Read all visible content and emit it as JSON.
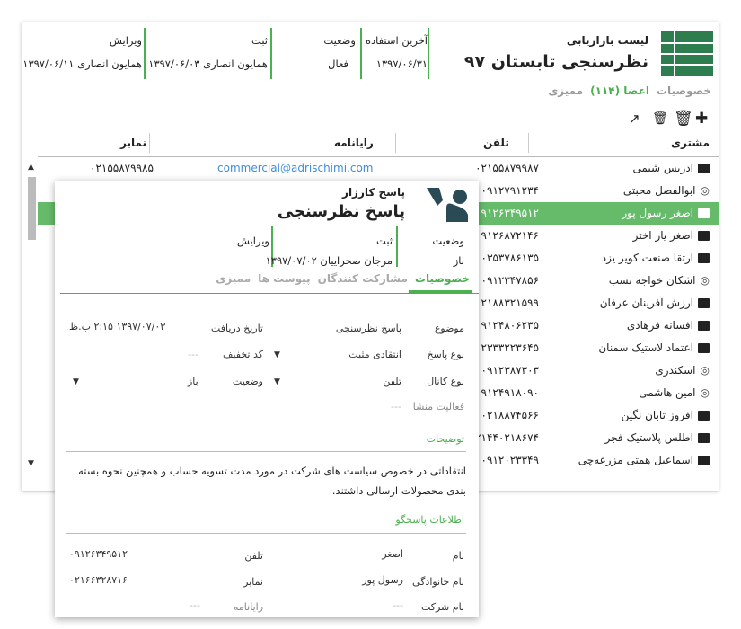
{
  "header": {
    "list_label": "لیست بازاریابی",
    "title": "نظرسنجی تابستان ۹۷",
    "fields": [
      {
        "label": "آخرین استفاده",
        "value": "۱۳۹۷/۰۶/۳۱"
      },
      {
        "label": "وضعیت",
        "value": "فعال"
      },
      {
        "label": "ثبت",
        "value": "همایون انصاری ۱۳۹۷/۰۶/۰۳"
      },
      {
        "label": "ویرایش",
        "value": "همایون انصاری ۱۳۹۷/۰۶/۱۱"
      }
    ],
    "tabs": [
      "خصوصیات",
      "اعضا (۱۱۴)",
      "ممیزی"
    ],
    "toolbar_icons": [
      "add-icon",
      "delete-icon",
      "delete-multiple-icon",
      "open-external-icon"
    ]
  },
  "table": {
    "columns": [
      "مشتری",
      "تلفن",
      "رایانامه",
      "نمابر"
    ],
    "rows": [
      {
        "name": "ادریس شیمی",
        "icon": "contact-card-icon",
        "phone": "۰۲۱۵۵۸۷۹۹۸۷",
        "email": "commercial@adrischimi.com",
        "fax": "۰۲۱۵۵۸۷۹۹۸۵"
      },
      {
        "name": "ابوالفضل محبتی",
        "icon": "fingerprint-icon",
        "phone": "۰۹۱۲۷۹۱۲۳۴",
        "email": "",
        "fax": ""
      },
      {
        "name": "اصغر رسول پور",
        "icon": "contact-card-icon",
        "phone": "۰۹۱۲۶۳۴۹۵۱۲",
        "email": "",
        "fax": "",
        "selected": true
      },
      {
        "name": "اصغر یار اختر",
        "icon": "contact-card-icon",
        "phone": "۰۹۱۲۶۸۷۲۱۴۶",
        "email": "",
        "fax": ""
      },
      {
        "name": "ارتقا صنعت کویر یزد",
        "icon": "contact-card-icon",
        "phone": "۰۳۵۳۷۸۶۱۳۵",
        "email": "",
        "fax": ""
      },
      {
        "name": "اشکان خواجه نسب",
        "icon": "fingerprint-icon",
        "phone": "۰۹۱۲۳۴۷۸۵۶",
        "email": "",
        "fax": ""
      },
      {
        "name": "ارزش آفرینان عرفان",
        "icon": "contact-card-icon",
        "phone": "۰۲۱۸۸۳۲۱۵۹۹",
        "email": "",
        "fax": ""
      },
      {
        "name": "افسانه فرهادی",
        "icon": "contact-card-icon",
        "phone": "۰۹۱۲۴۸۰۶۲۳۵",
        "email": "",
        "fax": ""
      },
      {
        "name": "اعتماد لاستیک سمنان",
        "icon": "contact-card-icon",
        "phone": "۰۲۳۳۳۲۲۳۶۴۵",
        "email": "",
        "fax": ""
      },
      {
        "name": "اسکندری",
        "icon": "fingerprint-icon",
        "phone": "۰۹۱۲۳۸۷۳۰۳",
        "email": "",
        "fax": ""
      },
      {
        "name": "امین هاشمی",
        "icon": "fingerprint-icon",
        "phone": "۰۹۱۲۴۹۱۸۰۹۰",
        "email": "",
        "fax": ""
      },
      {
        "name": "افروز تابان نگین",
        "icon": "contact-card-icon",
        "phone": "۰۲۱۸۸۷۴۵۶۶",
        "email": "",
        "fax": ""
      },
      {
        "name": "اطلس پلاستیک فجر",
        "icon": "contact-card-icon",
        "phone": "۰۲۱۴۴۰۲۱۸۶۷۴",
        "email": "",
        "fax": ""
      },
      {
        "name": "اسماعیل همتی مزرعه‌چی",
        "icon": "contact-card-icon",
        "phone": "۰۹۱۲۰۲۳۳۴۹",
        "email": "",
        "fax": ""
      }
    ]
  },
  "popup": {
    "subtitle": "پاسخ کارزار",
    "title": "پاسخ نظرسنجی",
    "fields": [
      {
        "label": "وضعیت",
        "value": "باز"
      },
      {
        "label": "ثبت",
        "value": "مرجان صحراییان ۱۳۹۷/۰۷/۰۲"
      },
      {
        "label": "ویرایش",
        "value": ""
      }
    ],
    "tabs": [
      "خصوصیات",
      "مشارکت کنندگان",
      "پیوست ها",
      "ممیزی"
    ],
    "form": {
      "subject_label": "موضوع",
      "subject_value": "پاسخ نظرسنجی",
      "received_label": "تاریخ دریافت",
      "received_value": "۱۳۹۷/۰۷/۰۳ ۲:۱۵ ب.ظ",
      "response_type_label": "نوع پاسخ",
      "response_type_value": "انتقادی مثبت",
      "discount_label": "کد تخفیف",
      "discount_value": "---",
      "channel_label": "نوع کانال",
      "channel_value": "تلفن",
      "status_label": "وضعیت",
      "status_value": "باز",
      "origin_label": "فعالیت منشا",
      "origin_value": "---"
    },
    "description_section": "توضیحات",
    "description": "انتقاداتی در خصوص سیاست های شرکت در مورد مدت تسویه حساب و همچنین نحوه بسته بندی محصولات ارسالی داشتند.",
    "responder_section": "اطلاعات پاسخگو",
    "responder": {
      "first_name_label": "نام",
      "first_name_value": "اصغر",
      "phone_label": "تلفن",
      "phone_value": "۰۹۱۲۶۳۴۹۵۱۲",
      "last_name_label": "نام خانوادگی",
      "last_name_value": "رسول پور",
      "fax_label": "نمابر",
      "fax_value": "۰۲۱۶۶۳۲۸۷۱۶",
      "company_label": "نام شرکت",
      "company_value": "---",
      "email_label": "رایانامه",
      "email_value": "---"
    }
  },
  "colors": {
    "accent": "#4caf50",
    "logo": "#2e7d4f",
    "selected_row": "#66bb6a",
    "link": "#3c8ddb"
  }
}
